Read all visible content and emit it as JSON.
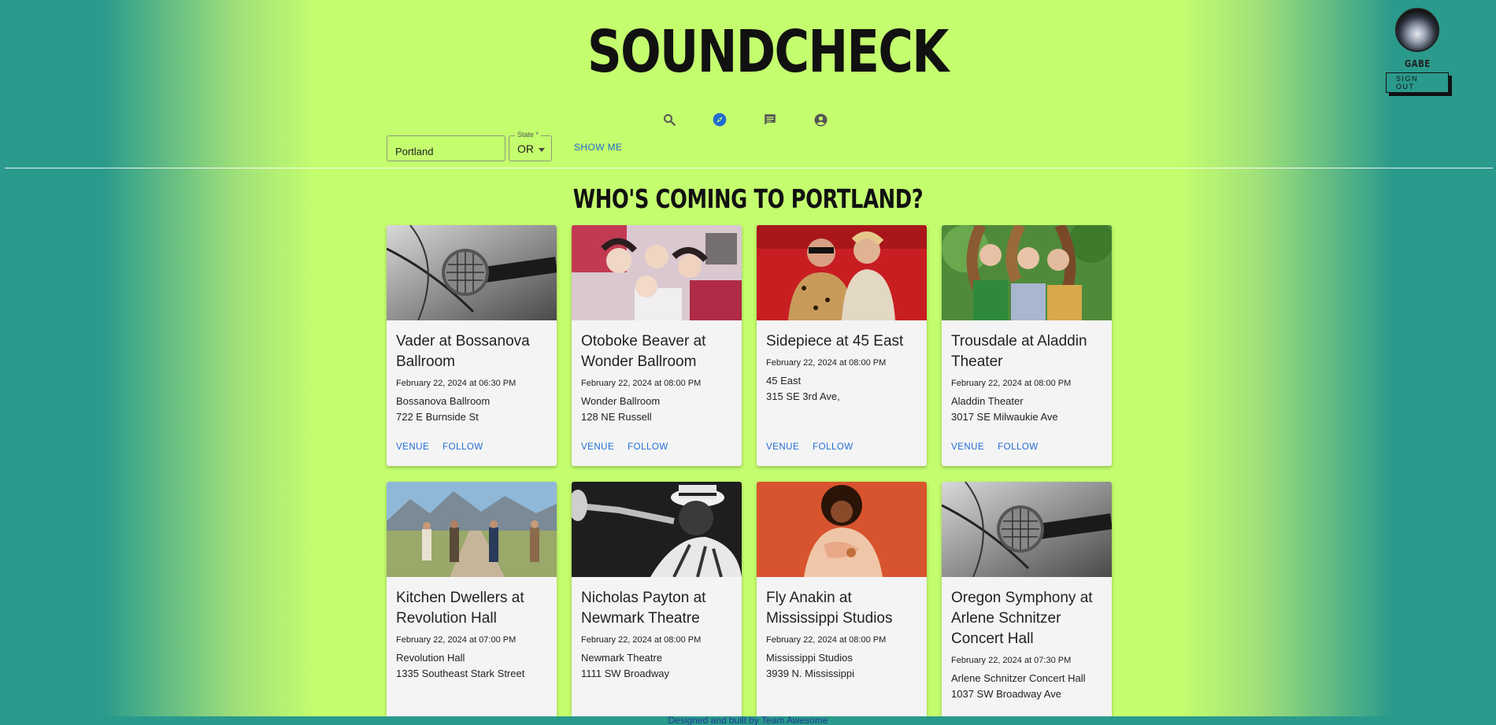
{
  "app": {
    "logo_text": "SOUNDCHECK"
  },
  "user": {
    "name": "GABE",
    "signout_label": "SIGN OUT"
  },
  "nav": {
    "items": [
      "search-icon",
      "compass-icon",
      "chat-icon",
      "account-icon"
    ],
    "active": "compass-icon",
    "active_color": "#1f6bd4"
  },
  "search": {
    "city_value": "Portland",
    "state_label": "State *",
    "state_value": "OR",
    "submit_label": "SHOW ME"
  },
  "headline": "WHO'S COMING TO PORTLAND?",
  "events": [
    {
      "title": "Vader at Bossanova Ballroom",
      "date": "February 22, 2024 at 06:30 PM",
      "venue": "Bossanova Ballroom",
      "address": "722 E Burnside St",
      "image": "microphone-photo",
      "venue_label": "VENUE",
      "follow_label": "FOLLOW"
    },
    {
      "title": "Otoboke Beaver at Wonder Ballroom",
      "date": "February 22, 2024 at 08:00 PM",
      "venue": "Wonder Ballroom",
      "address": "128 NE Russell",
      "image": "band-photo",
      "venue_label": "VENUE",
      "follow_label": "FOLLOW"
    },
    {
      "title": "Sidepiece at 45 East",
      "date": "February 22, 2024 at 08:00 PM",
      "venue": "45 East",
      "address": "315 SE 3rd Ave,",
      "image": "duo-photo",
      "venue_label": "VENUE",
      "follow_label": "FOLLOW"
    },
    {
      "title": "Trousdale at Aladdin Theater",
      "date": "February 22, 2024 at 08:00 PM",
      "venue": "Aladdin Theater",
      "address": "3017 SE Milwaukie Ave",
      "image": "trio-photo",
      "venue_label": "VENUE",
      "follow_label": "FOLLOW"
    },
    {
      "title": "Kitchen Dwellers at Revolution Hall",
      "date": "February 22, 2024 at 07:00 PM",
      "venue": "Revolution Hall",
      "address": "1335 Southeast Stark Street",
      "image": "band-road-photo"
    },
    {
      "title": "Nicholas Payton at Newmark Theatre",
      "date": "February 22, 2024 at 08:00 PM",
      "venue": "Newmark Theatre",
      "address": "1111 SW Broadway",
      "image": "trumpet-photo"
    },
    {
      "title": "Fly Anakin at Mississippi Studios",
      "date": "February 22, 2024 at 08:00 PM",
      "venue": "Mississippi Studios",
      "address": "3939 N. Mississippi",
      "image": "artist-photo"
    },
    {
      "title": "Oregon Symphony at Arlene Schnitzer Concert Hall",
      "date": "February 22, 2024 at 07:30 PM",
      "venue": "Arlene Schnitzer Concert Hall",
      "address": "1037 SW Broadway Ave",
      "image": "microphone-photo"
    }
  ],
  "footer": "Designed and built by Team Awesome",
  "colors": {
    "background": "#c4fd6e",
    "edge": "#2a9a8c",
    "link": "#1f6bd4"
  }
}
